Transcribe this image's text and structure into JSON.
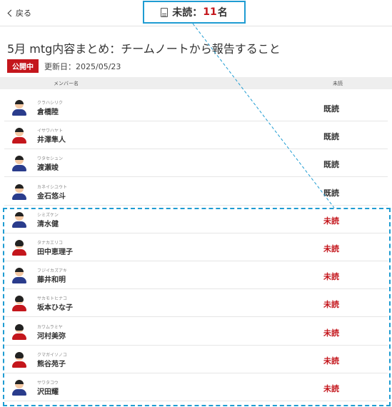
{
  "header": {
    "back_label": "戻る",
    "unread_label": "未読：",
    "unread_count": "11",
    "unread_suffix": "名"
  },
  "page": {
    "title": "5月 mtg内容まとめ：チームノートから報告すること",
    "badge": "公開中",
    "updated": "更新日：2025/05/23"
  },
  "list": {
    "col_name": "メンバー名",
    "col_status": "未読",
    "members": [
      {
        "kana": "クラハシリク",
        "name": "倉橋陸",
        "status": "既読"
      },
      {
        "kana": "イサワハヤト",
        "name": "井澤隼人",
        "status": "既読"
      },
      {
        "kana": "ワタセシュン",
        "name": "渡瀬竣",
        "status": "既読"
      },
      {
        "kana": "カネイシユウト",
        "name": "金石悠斗",
        "status": "既読"
      },
      {
        "kana": "シミズケン",
        "name": "清水健",
        "status": "未読"
      },
      {
        "kana": "タナカエリコ",
        "name": "田中恵理子",
        "status": "未読"
      },
      {
        "kana": "フジイカズアキ",
        "name": "藤井和明",
        "status": "未読"
      },
      {
        "kana": "サカモトヒナコ",
        "name": "坂本ひな子",
        "status": "未読"
      },
      {
        "kana": "カワムラミヤ",
        "name": "河村美弥",
        "status": "未読"
      },
      {
        "kana": "クマガイソノコ",
        "name": "熊谷苑子",
        "status": "未読"
      },
      {
        "kana": "サワタコウ",
        "name": "沢田耀",
        "status": "未読"
      }
    ]
  },
  "colors": {
    "accent": "#1f9cd2",
    "unread": "#c4161c"
  }
}
